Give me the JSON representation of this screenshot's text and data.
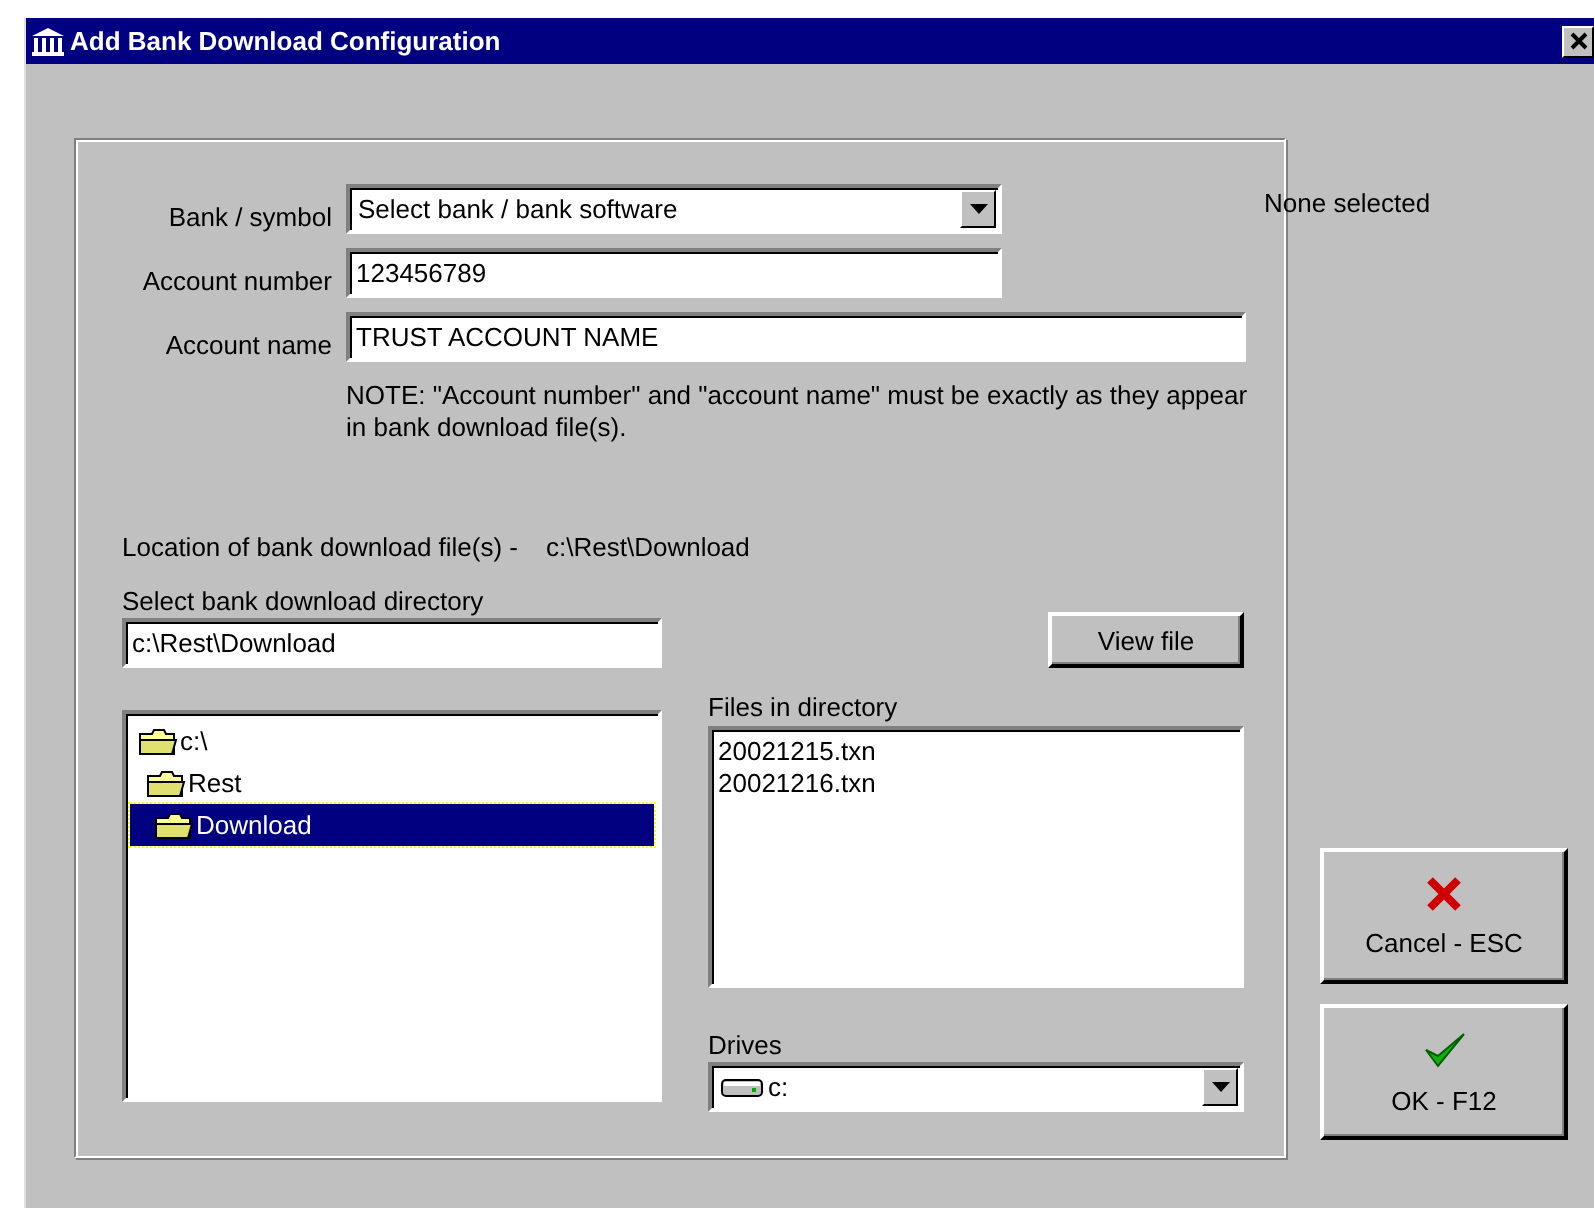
{
  "window": {
    "title": "Add Bank Download Configuration"
  },
  "bank_symbol": {
    "label": "Bank / symbol",
    "value": "Select bank / bank software",
    "status": "None selected"
  },
  "account_number": {
    "label": "Account number",
    "value": "123456789"
  },
  "account_name": {
    "label": "Account name",
    "value": "TRUST ACCOUNT NAME"
  },
  "note": "NOTE: \"Account number\" and \"account name\" must be exactly as they appear in bank download file(s).",
  "location": {
    "label": "Location of bank download file(s) -",
    "value": "c:\\Rest\\Download"
  },
  "directory": {
    "label": "Select bank download directory",
    "value": "c:\\Rest\\Download"
  },
  "directory_tree": [
    {
      "label": "c:\\",
      "selected": false,
      "children": [
        {
          "label": "Rest",
          "selected": false,
          "children": [
            {
              "label": "Download",
              "selected": true
            }
          ]
        }
      ]
    }
  ],
  "view_file_button": "View file",
  "files": {
    "label": "Files in directory",
    "items": [
      {
        "label": "20021215.txn"
      },
      {
        "label": "20021216.txn"
      }
    ]
  },
  "drives": {
    "label": "Drives",
    "value": "c:"
  },
  "buttons": [
    {
      "label": "Cancel - ESC",
      "kind": "cancel"
    },
    {
      "label": "OK - F12",
      "kind": "ok"
    }
  ]
}
